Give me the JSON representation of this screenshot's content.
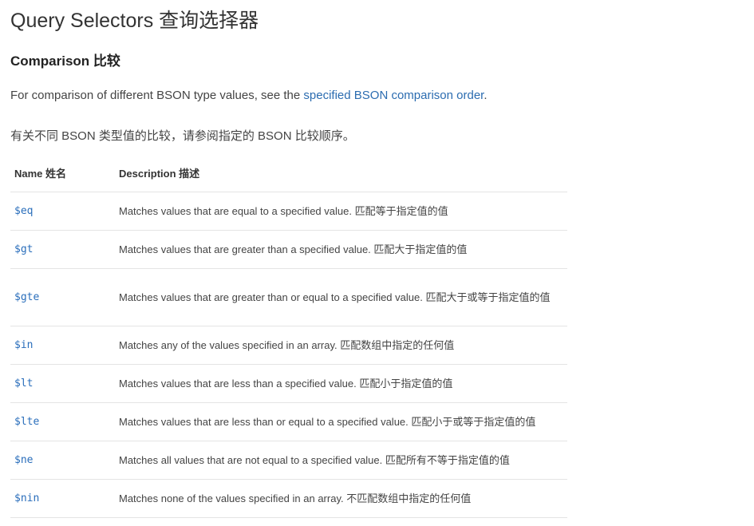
{
  "header": {
    "title": "Query Selectors 查询选择器"
  },
  "section": {
    "title": "Comparison 比较"
  },
  "intro": {
    "en_prefix": "For comparison of different BSON type values, see the ",
    "en_link": "specified BSON comparison order",
    "en_suffix": ".",
    "zh": "有关不同 BSON 类型值的比较，请参阅指定的 BSON 比较顺序。"
  },
  "table": {
    "columns": [
      "Name 姓名",
      "Description 描述"
    ],
    "rows": [
      {
        "name": "$eq",
        "description": "Matches values that are equal to a specified value. 匹配等于指定值的值"
      },
      {
        "name": "$gt",
        "description": "Matches values that are greater than a specified value. 匹配大于指定值的值"
      },
      {
        "name": "$gte",
        "description": "Matches values that are greater than or equal to a specified value. 匹配大于或等于指定值的值"
      },
      {
        "name": "$in",
        "description": "Matches any of the values specified in an array. 匹配数组中指定的任何值"
      },
      {
        "name": "$lt",
        "description": "Matches values that are less than a specified value. 匹配小于指定值的值"
      },
      {
        "name": "$lte",
        "description": "Matches values that are less than or equal to a specified value. 匹配小于或等于指定值的值"
      },
      {
        "name": "$ne",
        "description": "Matches all values that are not equal to a specified value. 匹配所有不等于指定值的值"
      },
      {
        "name": "$nin",
        "description": "Matches none of the values specified in an array. 不匹配数组中指定的任何值"
      }
    ]
  },
  "colors": {
    "link": "#2b6cb0",
    "code": "#2a6ebb",
    "divider": "#e4e4e4"
  }
}
